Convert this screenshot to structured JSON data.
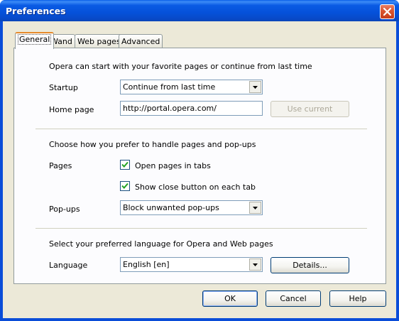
{
  "window": {
    "title": "Preferences"
  },
  "tabs": [
    {
      "label": "General"
    },
    {
      "label": "Wand"
    },
    {
      "label": "Web pages"
    },
    {
      "label": "Advanced"
    }
  ],
  "startup_section": {
    "heading": "Opera can start with your favorite pages or continue from last time",
    "startup_label": "Startup",
    "startup_value": "Continue from last time",
    "homepage_label": "Home page",
    "homepage_value": "http://portal.opera.com/",
    "use_current_label": "Use current"
  },
  "pages_section": {
    "heading": "Choose how you prefer to handle pages and pop-ups",
    "pages_label": "Pages",
    "open_in_tabs_label": "Open pages in tabs",
    "open_in_tabs_checked": true,
    "show_close_label": "Show close button on each tab",
    "show_close_checked": true,
    "popups_label": "Pop-ups",
    "popups_value": "Block unwanted pop-ups"
  },
  "language_section": {
    "heading": "Select your preferred language for Opera and Web pages",
    "language_label": "Language",
    "language_value": "English [en]",
    "details_label": "Details..."
  },
  "footer": {
    "ok_label": "OK",
    "cancel_label": "Cancel",
    "help_label": "Help"
  }
}
